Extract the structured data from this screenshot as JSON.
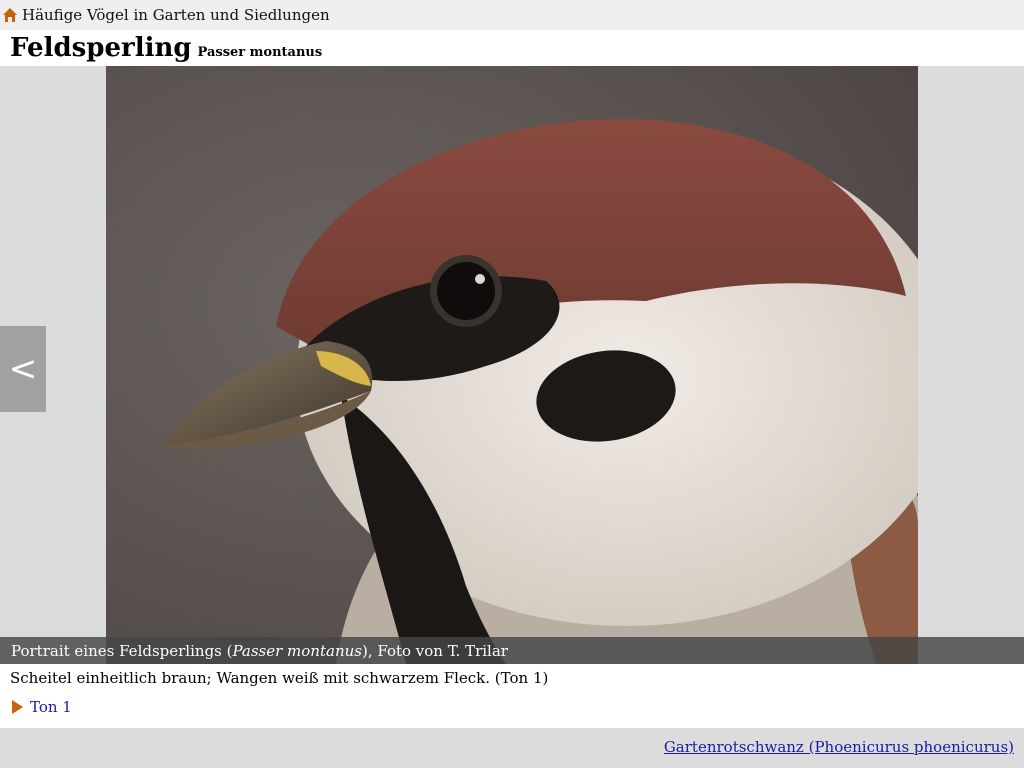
{
  "breadcrumb": {
    "icon": "home-icon",
    "label": "Häufige Vögel in Garten und Siedlungen"
  },
  "header": {
    "title": "Feldsperling",
    "latin_name": "Passer montanus"
  },
  "photo": {
    "alt": "Portrait eines Feldsperlings"
  },
  "gallery": {
    "prev_label": "<"
  },
  "caption": {
    "prefix": "Portrait eines Feldsperlings (",
    "species_italic": "Passer montanus",
    "suffix": "), Foto von T. Trilar"
  },
  "description": "Scheitel einheitlich braun; Wangen weiß mit schwarzem Fleck.  (Ton 1)",
  "sound": {
    "icon": "play-icon",
    "label": "Ton 1"
  },
  "footer": {
    "next_link": "Gartenrotschwanz (Phoenicurus phoenicurus)"
  },
  "colors": {
    "link": "#1a1aa8",
    "accent_orange": "#c8620a",
    "topbar_bg": "#efefef",
    "gallery_bg": "#dcdcdc"
  }
}
